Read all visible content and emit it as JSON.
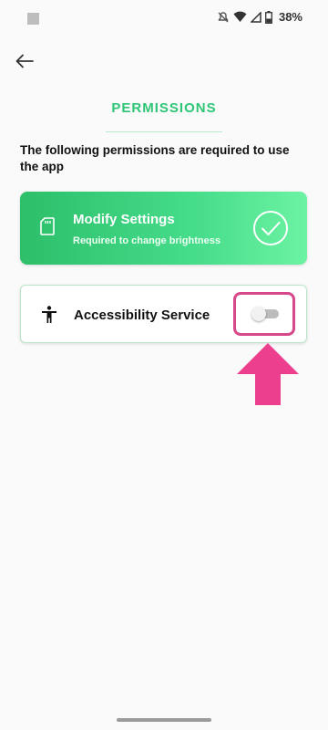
{
  "status_bar": {
    "battery_percent": "38%",
    "icons": [
      "mute-icon",
      "wifi-icon",
      "signal-icon",
      "battery-icon"
    ]
  },
  "header": {
    "back_icon": "arrow-left-icon",
    "title": "PERMISSIONS"
  },
  "intro": {
    "text": "The following permissions are required to use the app"
  },
  "permissions": [
    {
      "icon": "sd-card-icon",
      "title": "Modify Settings",
      "subtitle": "Required to change brightness",
      "granted": true,
      "status_icon": "check-circle-icon"
    },
    {
      "icon": "accessibility-icon",
      "title": "Accessibility Service",
      "granted": false,
      "control": "toggle-switch",
      "toggle_on": false
    }
  ],
  "annotation": {
    "highlight_color": "#d6478b",
    "arrow_color": "#ec3f8e",
    "arrow_icon": "arrow-up-icon"
  },
  "colors": {
    "accent": "#2ec676",
    "card_gradient_start": "#2dbf6a",
    "card_gradient_end": "#6cf3a3",
    "background": "#fafafa"
  }
}
